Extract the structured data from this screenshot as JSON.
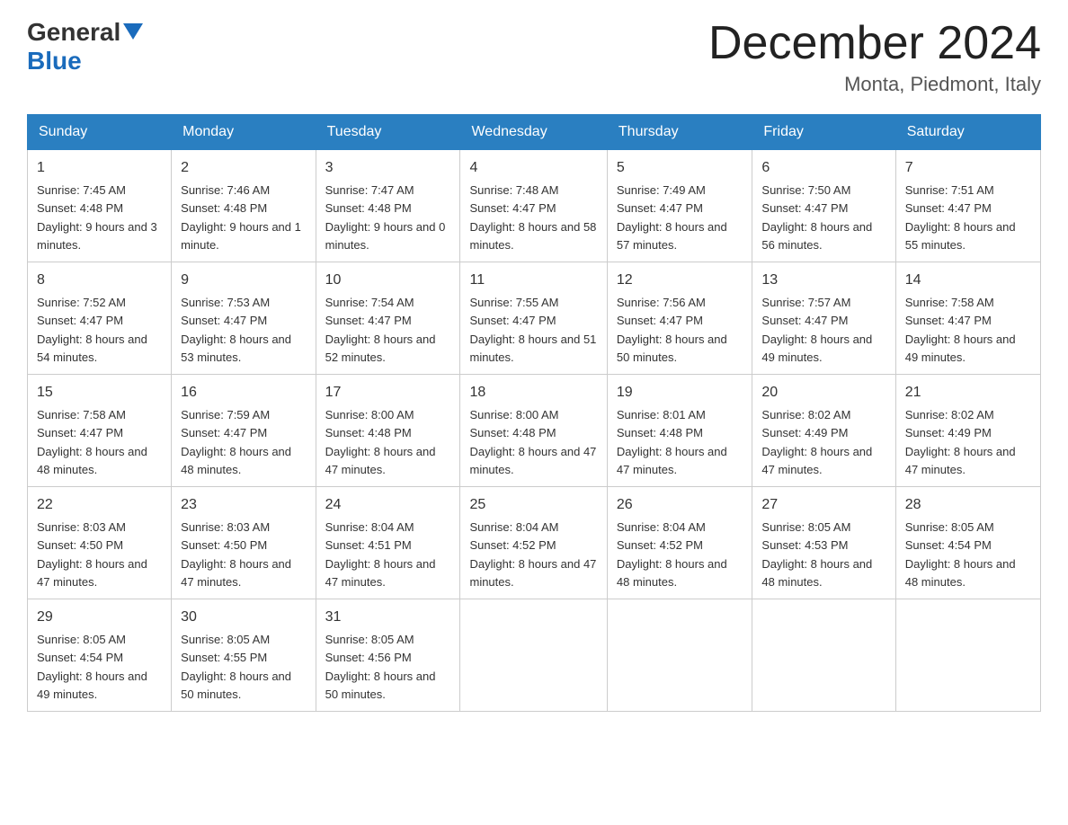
{
  "header": {
    "logo_general": "General",
    "logo_blue": "Blue",
    "title": "December 2024",
    "location": "Monta, Piedmont, Italy"
  },
  "calendar": {
    "days_of_week": [
      "Sunday",
      "Monday",
      "Tuesday",
      "Wednesday",
      "Thursday",
      "Friday",
      "Saturday"
    ],
    "weeks": [
      [
        {
          "date": "1",
          "sunrise": "7:45 AM",
          "sunset": "4:48 PM",
          "daylight": "9 hours and 3 minutes."
        },
        {
          "date": "2",
          "sunrise": "7:46 AM",
          "sunset": "4:48 PM",
          "daylight": "9 hours and 1 minute."
        },
        {
          "date": "3",
          "sunrise": "7:47 AM",
          "sunset": "4:48 PM",
          "daylight": "9 hours and 0 minutes."
        },
        {
          "date": "4",
          "sunrise": "7:48 AM",
          "sunset": "4:47 PM",
          "daylight": "8 hours and 58 minutes."
        },
        {
          "date": "5",
          "sunrise": "7:49 AM",
          "sunset": "4:47 PM",
          "daylight": "8 hours and 57 minutes."
        },
        {
          "date": "6",
          "sunrise": "7:50 AM",
          "sunset": "4:47 PM",
          "daylight": "8 hours and 56 minutes."
        },
        {
          "date": "7",
          "sunrise": "7:51 AM",
          "sunset": "4:47 PM",
          "daylight": "8 hours and 55 minutes."
        }
      ],
      [
        {
          "date": "8",
          "sunrise": "7:52 AM",
          "sunset": "4:47 PM",
          "daylight": "8 hours and 54 minutes."
        },
        {
          "date": "9",
          "sunrise": "7:53 AM",
          "sunset": "4:47 PM",
          "daylight": "8 hours and 53 minutes."
        },
        {
          "date": "10",
          "sunrise": "7:54 AM",
          "sunset": "4:47 PM",
          "daylight": "8 hours and 52 minutes."
        },
        {
          "date": "11",
          "sunrise": "7:55 AM",
          "sunset": "4:47 PM",
          "daylight": "8 hours and 51 minutes."
        },
        {
          "date": "12",
          "sunrise": "7:56 AM",
          "sunset": "4:47 PM",
          "daylight": "8 hours and 50 minutes."
        },
        {
          "date": "13",
          "sunrise": "7:57 AM",
          "sunset": "4:47 PM",
          "daylight": "8 hours and 49 minutes."
        },
        {
          "date": "14",
          "sunrise": "7:58 AM",
          "sunset": "4:47 PM",
          "daylight": "8 hours and 49 minutes."
        }
      ],
      [
        {
          "date": "15",
          "sunrise": "7:58 AM",
          "sunset": "4:47 PM",
          "daylight": "8 hours and 48 minutes."
        },
        {
          "date": "16",
          "sunrise": "7:59 AM",
          "sunset": "4:47 PM",
          "daylight": "8 hours and 48 minutes."
        },
        {
          "date": "17",
          "sunrise": "8:00 AM",
          "sunset": "4:48 PM",
          "daylight": "8 hours and 47 minutes."
        },
        {
          "date": "18",
          "sunrise": "8:00 AM",
          "sunset": "4:48 PM",
          "daylight": "8 hours and 47 minutes."
        },
        {
          "date": "19",
          "sunrise": "8:01 AM",
          "sunset": "4:48 PM",
          "daylight": "8 hours and 47 minutes."
        },
        {
          "date": "20",
          "sunrise": "8:02 AM",
          "sunset": "4:49 PM",
          "daylight": "8 hours and 47 minutes."
        },
        {
          "date": "21",
          "sunrise": "8:02 AM",
          "sunset": "4:49 PM",
          "daylight": "8 hours and 47 minutes."
        }
      ],
      [
        {
          "date": "22",
          "sunrise": "8:03 AM",
          "sunset": "4:50 PM",
          "daylight": "8 hours and 47 minutes."
        },
        {
          "date": "23",
          "sunrise": "8:03 AM",
          "sunset": "4:50 PM",
          "daylight": "8 hours and 47 minutes."
        },
        {
          "date": "24",
          "sunrise": "8:04 AM",
          "sunset": "4:51 PM",
          "daylight": "8 hours and 47 minutes."
        },
        {
          "date": "25",
          "sunrise": "8:04 AM",
          "sunset": "4:52 PM",
          "daylight": "8 hours and 47 minutes."
        },
        {
          "date": "26",
          "sunrise": "8:04 AM",
          "sunset": "4:52 PM",
          "daylight": "8 hours and 48 minutes."
        },
        {
          "date": "27",
          "sunrise": "8:05 AM",
          "sunset": "4:53 PM",
          "daylight": "8 hours and 48 minutes."
        },
        {
          "date": "28",
          "sunrise": "8:05 AM",
          "sunset": "4:54 PM",
          "daylight": "8 hours and 48 minutes."
        }
      ],
      [
        {
          "date": "29",
          "sunrise": "8:05 AM",
          "sunset": "4:54 PM",
          "daylight": "8 hours and 49 minutes."
        },
        {
          "date": "30",
          "sunrise": "8:05 AM",
          "sunset": "4:55 PM",
          "daylight": "8 hours and 50 minutes."
        },
        {
          "date": "31",
          "sunrise": "8:05 AM",
          "sunset": "4:56 PM",
          "daylight": "8 hours and 50 minutes."
        },
        null,
        null,
        null,
        null
      ]
    ]
  }
}
